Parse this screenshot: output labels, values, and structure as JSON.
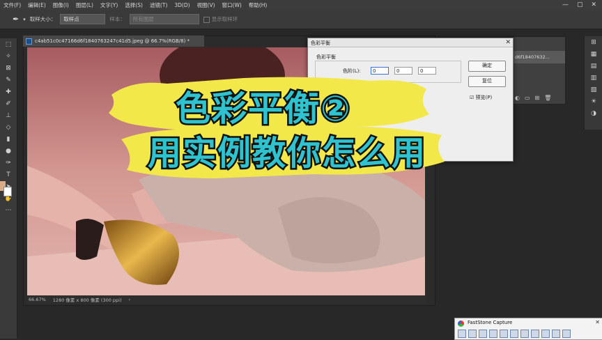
{
  "menu": [
    "文件(F)",
    "编辑(E)",
    "图像(I)",
    "图层(L)",
    "文字(Y)",
    "选择(S)",
    "滤镜(T)",
    "3D(D)",
    "视图(V)",
    "窗口(W)",
    "帮助(H)"
  ],
  "window_controls": [
    "—",
    "▢",
    "✕"
  ],
  "options": {
    "sample_size_label": "取样大小：",
    "sample_size_value": "取样点",
    "sample_label": "样本：",
    "sample_value": "所有图层",
    "show_ring": "显示取样环"
  },
  "document": {
    "tab_title": "c4ab51c0c47166d6f1840763247c41d5.jpeg @ 66.7%(RGB/8) *",
    "zoom": "66.67%",
    "doc_info": "1280 像素 x 800 像素 (300 ppi)",
    "arrow": "›"
  },
  "dialog": {
    "title": "色彩平衡",
    "close": "✕",
    "group_label": "色彩平衡",
    "levels_label": "色阶(L):",
    "levels": [
      "0",
      "0",
      "0"
    ],
    "ok": "确定",
    "reset": "复位",
    "preview": "预览(P)"
  },
  "layers_panel": {
    "layer_name": "d6f18407632..."
  },
  "banner": {
    "line1": "色彩平衡②",
    "line2": "用实例教你怎么用"
  },
  "faststone": {
    "title": "FastStone Capture"
  },
  "colors": {
    "banner_fill": "#2ec3cf",
    "banner_brush": "#f2e84a",
    "foreground": "#d9ad87",
    "background": "#ffffff"
  }
}
